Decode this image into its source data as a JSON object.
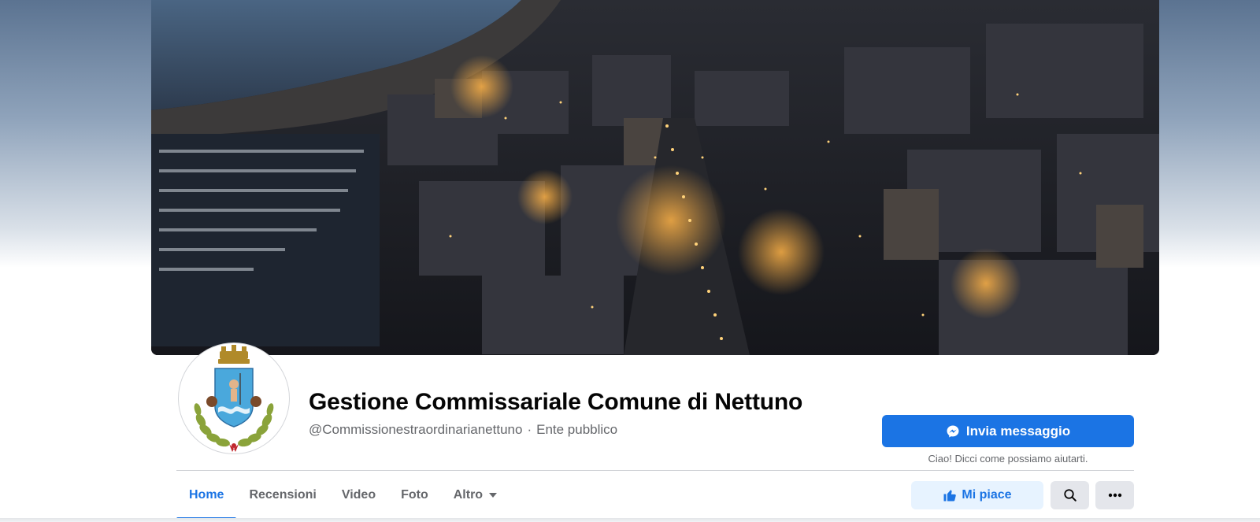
{
  "cover": {
    "alt": "Veduta notturna aerea di Nettuno"
  },
  "page": {
    "name": "Gestione Commissariale Comune di Nettuno",
    "handle": "@Commissionestraordinarianettuno",
    "separator": "·",
    "category": "Ente pubblico"
  },
  "actions": {
    "message_label": "Invia messaggio",
    "message_icon": "messenger-icon",
    "greeting": "Ciao! Dicci come possiamo aiutarti.",
    "like_label": "Mi piace",
    "like_icon": "thumbs-up-icon",
    "search_icon": "search-icon",
    "more_icon": "more-dots-icon"
  },
  "tabs": [
    {
      "label": "Home",
      "active": true
    },
    {
      "label": "Recensioni"
    },
    {
      "label": "Video"
    },
    {
      "label": "Foto"
    },
    {
      "label": "Altro"
    }
  ],
  "colors": {
    "accent": "#1b74e4",
    "accent_light": "#e7f3ff",
    "text_primary": "#050505",
    "text_secondary": "#65676b",
    "button_gray": "#e4e6eb"
  }
}
